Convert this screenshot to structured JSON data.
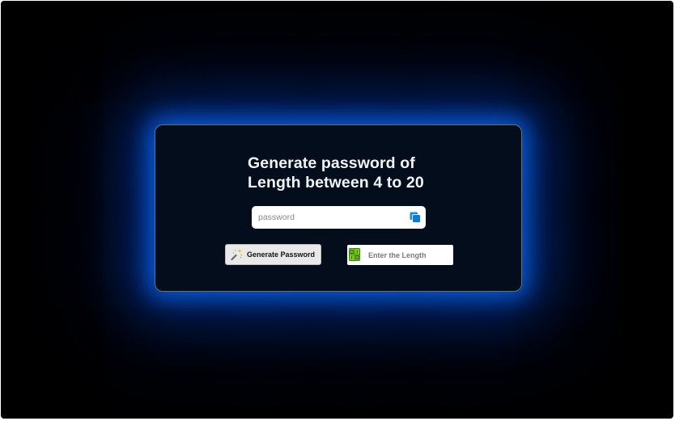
{
  "card": {
    "title_line1": "Generate password of",
    "title_line2": "Length between 4 to 20"
  },
  "password_field": {
    "placeholder": "password",
    "value": "",
    "copy_icon": "copy-icon"
  },
  "generate_button": {
    "label": "Generate Password",
    "icon": "magic-wand-icon"
  },
  "length_field": {
    "placeholder": "Enter the Length",
    "value": "",
    "icon": "counter-icon"
  },
  "colors": {
    "page_background": "#000000",
    "card_background": "#030d1c",
    "card_border": "#5d6f84",
    "glow": "#0e6eff",
    "title_text": "#f2f5f8",
    "copy_icon": "#1e88e5",
    "button_background": "#e9e9e9",
    "counter_icon_fill": "#7ed321"
  }
}
